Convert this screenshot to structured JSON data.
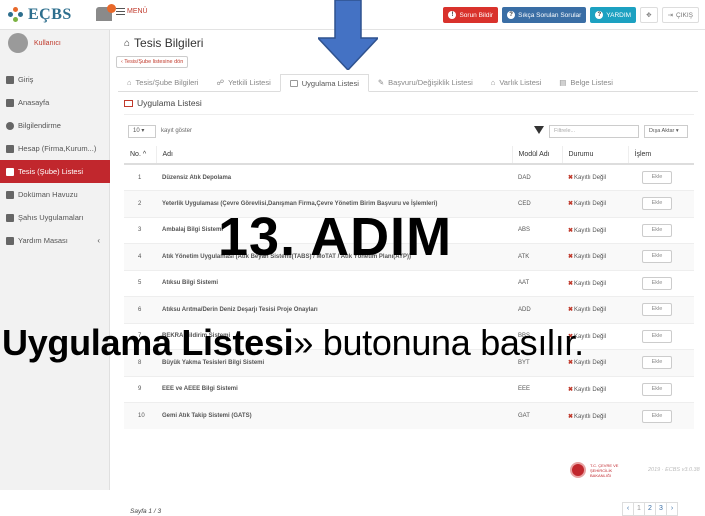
{
  "topbar": {
    "logo_text": "EÇBS",
    "menu_label": "MENÜ",
    "buttons": {
      "report_problem": "Sorun Bildir",
      "faq": "Sıkça Sorulan Sorular",
      "help": "YARDIM",
      "logout": "ÇIKIŞ"
    }
  },
  "sidebar": {
    "user_name": "Kullanıcı",
    "items": [
      {
        "label": "Giriş"
      },
      {
        "label": "Anasayfa"
      },
      {
        "label": "Bilgilendirme"
      },
      {
        "label": "Hesap (Firma,Kurum...)"
      },
      {
        "label": "Tesis (Şube) Listesi"
      },
      {
        "label": "Doküman Havuzu"
      },
      {
        "label": "Şahıs Uygulamaları"
      },
      {
        "label": "Yardım Masası"
      }
    ]
  },
  "main": {
    "page_title": "Tesis Bilgileri",
    "back_link": "Tesis/Şube listesine dön",
    "tabs": [
      {
        "label": "Tesis/Şube Bilgileri"
      },
      {
        "label": "Yetkili Listesi"
      },
      {
        "label": "Uygulama Listesi"
      },
      {
        "label": "Başvuru/Değişiklik Listesi"
      },
      {
        "label": "Varlık Listesi"
      },
      {
        "label": "Belge Listesi"
      }
    ],
    "panel_title": "Uygulama Listesi",
    "page_size": "10",
    "page_size_label": "kayıt göster",
    "filter_placeholder": "Filtrele...",
    "export_label": "Dışa Aktar",
    "columns": {
      "no": "No.",
      "name": "Adı",
      "module": "Modül Adı",
      "status": "Durumu",
      "action": "İşlem"
    },
    "rows": [
      {
        "no": "1",
        "name": "Düzensiz Atık Depolama",
        "module": "DAD",
        "status": "Kayıtlı Değil",
        "action": "Ekle"
      },
      {
        "no": "2",
        "name": "Yeterlik Uygulaması (Çevre Görevlisi,Danışman Firma,Çevre Yönetim Birim Başvuru ve İşlemleri)",
        "module": "CED",
        "status": "Kayıtlı Değil",
        "action": "Ekle"
      },
      {
        "no": "3",
        "name": "Ambalaj Bilgi Sistemi",
        "module": "ABS",
        "status": "Kayıtlı Değil",
        "action": "Ekle"
      },
      {
        "no": "4",
        "name": "Atık Yönetim Uygulaması (Atık Beyan Sistemi(TABS) / MoTAT / Atık Yönetim Planı(AYP))",
        "module": "ATK",
        "status": "Kayıtlı Değil",
        "action": "Ekle"
      },
      {
        "no": "5",
        "name": "Atıksu Bilgi Sistemi",
        "module": "AAT",
        "status": "Kayıtlı Değil",
        "action": "Ekle"
      },
      {
        "no": "6",
        "name": "Atıksu Arıtma/Derin Deniz Deşarjı Tesisi Proje Onayları",
        "module": "ADD",
        "status": "Kayıtlı Değil",
        "action": "Ekle"
      },
      {
        "no": "7",
        "name": "BEKRA Bildirim Sistemi",
        "module": "BBS",
        "status": "Kayıtlı Değil",
        "action": "Ekle"
      },
      {
        "no": "8",
        "name": "Büyük Yakma Tesisleri Bilgi Sistemi",
        "module": "BYT",
        "status": "Kayıtlı Değil",
        "action": "Ekle"
      },
      {
        "no": "9",
        "name": "EEE ve AEEE Bilgi Sistemi",
        "module": "EEE",
        "status": "Kayıtlı Değil",
        "action": "Ekle"
      },
      {
        "no": "10",
        "name": "Gemi Atık Takip Sistemi (GATS)",
        "module": "GAT",
        "status": "Kayıtlı Değil",
        "action": "Ekle"
      }
    ],
    "page_info": "Sayfa 1 / 3",
    "pager": [
      "‹",
      "1",
      "2",
      "3",
      "›"
    ],
    "ministry": "T.C. ÇEVRE VE ŞEHİRCİLİK BAKANLIĞI",
    "copyright": "2019 · ECBS v3.0.38"
  },
  "overlay": {
    "step": "13. ADIM",
    "instruction_bold": "Uygulama Listesi",
    "instruction_rest": "» butonuna basılır."
  }
}
